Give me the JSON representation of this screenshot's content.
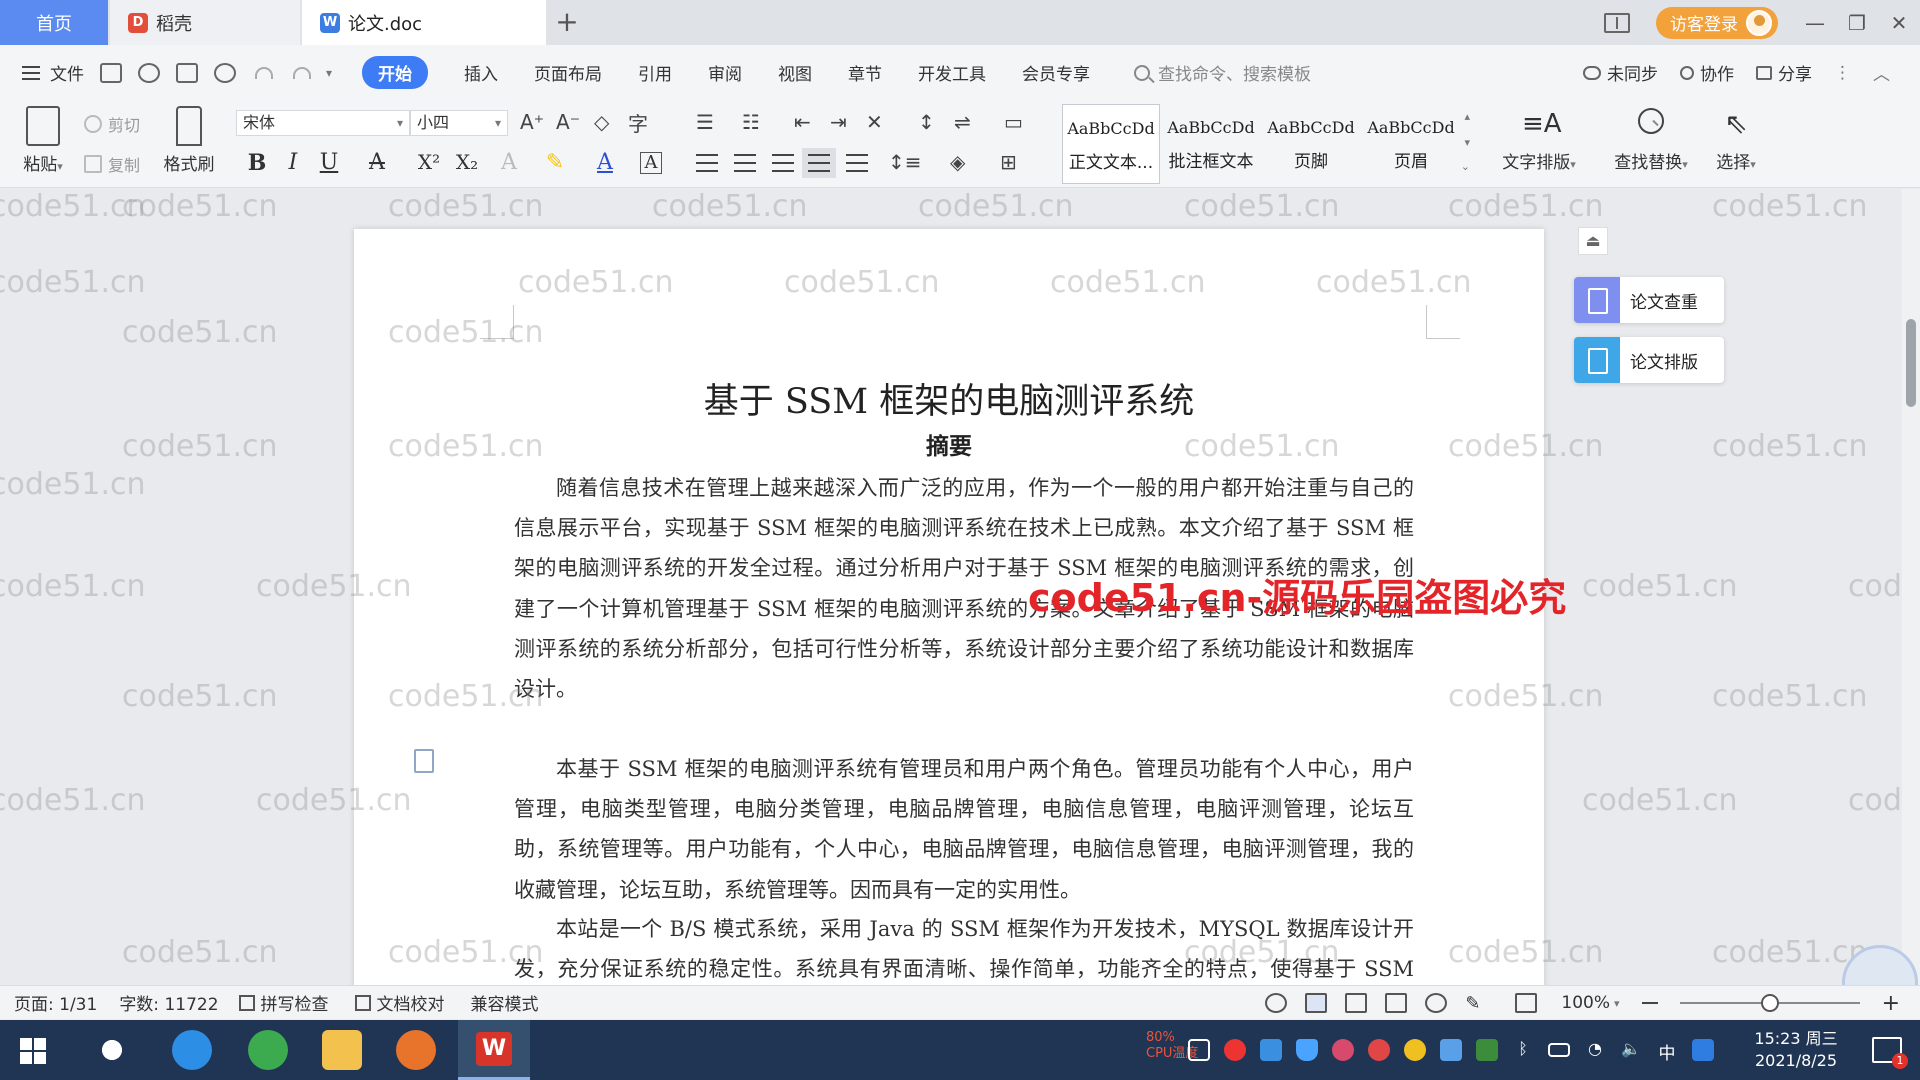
{
  "tabs": {
    "home": "首页",
    "daoke": "稻壳",
    "doc": "论文.doc",
    "new_tab": "+"
  },
  "titlebar": {
    "login": "访客登录"
  },
  "menu": {
    "file": "文件",
    "tabs": [
      "开始",
      "插入",
      "页面布局",
      "引用",
      "审阅",
      "视图",
      "章节",
      "开发工具",
      "会员专享"
    ],
    "search_placeholder": "查找命令、搜索模板",
    "sync": "未同步",
    "collab": "协作",
    "share": "分享"
  },
  "ribbon": {
    "paste": "粘贴",
    "cut": "剪切",
    "copy": "复制",
    "format_painter": "格式刷",
    "font_name": "宋体",
    "font_size": "小四",
    "styles": [
      {
        "sample": "AaBbCcDd",
        "name": "正文文本..."
      },
      {
        "sample": "AaBbCcDd",
        "name": "批注框文本"
      },
      {
        "sample": "AaBbCcDd",
        "name": "页脚"
      },
      {
        "sample": "AaBbCcDd",
        "name": "页眉"
      }
    ],
    "text_layout": "文字排版",
    "find_replace": "查找替换",
    "select": "选择"
  },
  "side_panel": {
    "check": "论文查重",
    "format": "论文排版"
  },
  "document": {
    "title": "基于 SSM 框架的电脑测评系统",
    "abstract_heading": "摘要",
    "paragraphs": [
      "随着信息技术在管理上越来越深入而广泛的应用，作为一个一般的用户都开始注重与自己的信息展示平台，实现基于 SSM 框架的电脑测评系统在技术上已成熟。本文介绍了基于 SSM 框架的电脑测评系统的开发全过程。通过分析用户对于基于 SSM 框架的电脑测评系统的需求，创建了一个计算机管理基于 SSM 框架的电脑测评系统的方案。文章介绍了基于 SSM 框架的电脑测评系统的系统分析部分，包括可行性分析等，系统设计部分主要介绍了系统功能设计和数据库设计。",
      "本基于 SSM 框架的电脑测评系统有管理员和用户两个角色。管理员功能有个人中心，用户管理，电脑类型管理，电脑分类管理，电脑品牌管理，电脑信息管理，电脑评测管理，论坛互助，系统管理等。用户功能有，个人中心，电脑品牌管理，电脑信息管理，电脑评测管理，我的收藏管理，论坛互助，系统管理等。因而具有一定的实用性。",
      "本站是一个 B/S 模式系统，采用 Java 的 SSM 框架作为开发技术，MYSQL 数据库设计开发，充分保证系统的稳定性。系统具有界面清晰、操作简单，功能齐全的特点，使得基于 SSM 框架的电脑测评系统管理工作系统化、规范化。"
    ],
    "watermark": "code51.cn",
    "red_watermark": "code51.cn-源码乐园盗图必究"
  },
  "statusbar": {
    "page": "页面: 1/31",
    "words": "字数: 11722",
    "spell": "拼写检查",
    "proof": "文档校对",
    "compat": "兼容模式",
    "zoom": "100%",
    "zoom_fraction": 0.5
  },
  "taskbar": {
    "cpu_percent": "80%",
    "cpu_label": "CPU温度",
    "ime": "中",
    "time": "15:23 周三",
    "date": "2021/8/25",
    "notification_count": "1"
  },
  "colors": {
    "accent": "#3e7cf5",
    "home_tab": "#5b8bf0",
    "login": "#f3a13b",
    "red_watermark": "#e3252a",
    "taskbar": "#1f3553"
  }
}
